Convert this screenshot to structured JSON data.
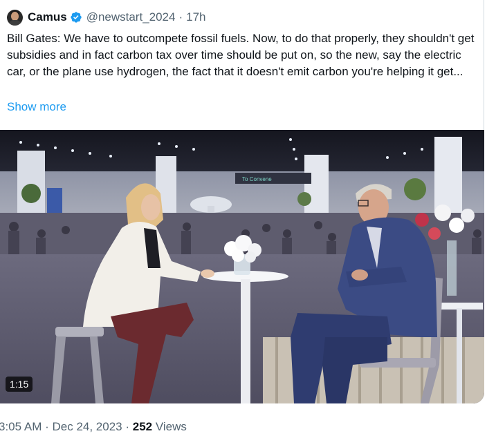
{
  "tweet": {
    "author_name": "Camus",
    "handle": "@newstart_2024",
    "age": "17h",
    "text": "Bill Gates: We have to outcompete fossil fuels. Now, to do that properly, they shouldn't get subsidies and in fact carbon tax over time should be put on, so the new, say the electric car, or the plane use hydrogen, the fact that it doesn't emit carbon you're helping it get...",
    "show_more": "Show more",
    "media": {
      "duration": "1:15",
      "sign_text": "To Convene"
    },
    "meta": {
      "time": "3:05 AM",
      "date": "Dec 24, 2023",
      "views_count": "252",
      "views_label": "Views"
    }
  },
  "icons": {
    "verified": "verified-badge-icon",
    "avatar": "avatar-image"
  },
  "colors": {
    "link": "#1d9bf0",
    "secondary_text": "#536471",
    "verified": "#1d9bf0"
  }
}
